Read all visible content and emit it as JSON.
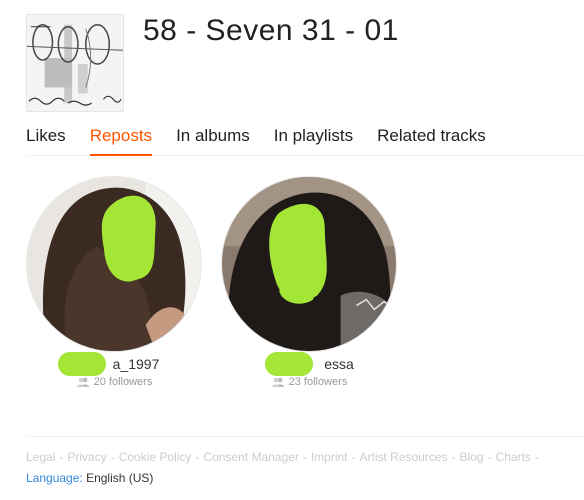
{
  "track": {
    "title": "58 - Seven 31 - 01",
    "artwork_icon": "sketch-artwork"
  },
  "tabs": [
    {
      "label": "Likes",
      "active": false
    },
    {
      "label": "Reposts",
      "active": true
    },
    {
      "label": "In albums",
      "active": false
    },
    {
      "label": "In playlists",
      "active": false
    },
    {
      "label": "Related tracks",
      "active": false
    }
  ],
  "users": [
    {
      "username": "a_1997",
      "followers": "20 followers",
      "avatar_icon": "user-avatar"
    },
    {
      "username": "essa",
      "followers": "23 followers",
      "avatar_icon": "user-avatar"
    }
  ],
  "footer": {
    "links": [
      "Legal",
      "Privacy",
      "Cookie Policy",
      "Consent Manager",
      "Imprint",
      "Artist Resources",
      "Blog",
      "Charts"
    ],
    "language_label": "Language:",
    "language_value": "English (US)"
  },
  "colors": {
    "accent": "#ff5500",
    "link_blue": "#3388dd",
    "redaction": "#a3e635"
  }
}
